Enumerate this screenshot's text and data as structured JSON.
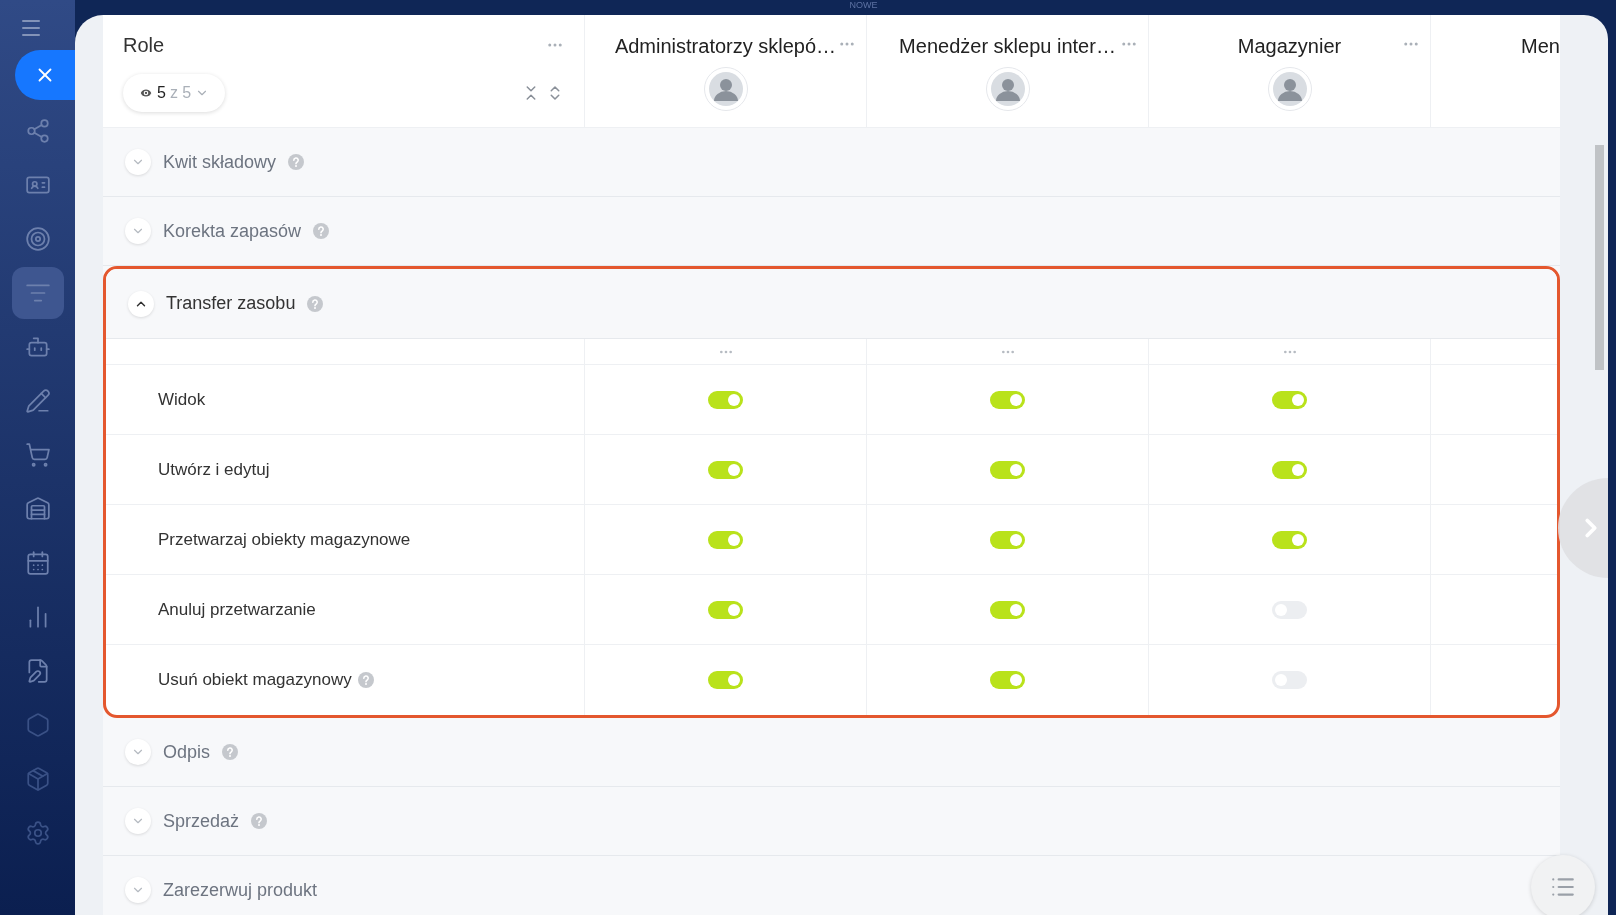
{
  "top_label": "NOWE",
  "roles_header": {
    "title": "Role",
    "visible_count": "5",
    "total_label": "z 5"
  },
  "columns": [
    {
      "title": "Administratorzy sklepó…",
      "avatar": true
    },
    {
      "title": "Menedżer sklepu inter…",
      "avatar": true
    },
    {
      "title": "Magazynier",
      "avatar": true
    },
    {
      "title": "Men",
      "avatar": false
    }
  ],
  "sections": [
    {
      "title": "Kwit składowy",
      "expanded": false,
      "highlighted": false,
      "help": true
    },
    {
      "title": "Korekta zapasów",
      "expanded": false,
      "highlighted": false,
      "help": true
    },
    {
      "title": "Transfer zasobu",
      "expanded": true,
      "highlighted": true,
      "help": true,
      "permissions": [
        {
          "label": "Widok",
          "help": false,
          "values": [
            {
              "on": true
            },
            {
              "on": true
            },
            {
              "on": true
            }
          ]
        },
        {
          "label": "Utwórz i edytuj",
          "help": false,
          "values": [
            {
              "on": true
            },
            {
              "on": true
            },
            {
              "on": true
            }
          ]
        },
        {
          "label": "Przetwarzaj obiekty magazynowe",
          "help": false,
          "values": [
            {
              "on": true
            },
            {
              "on": true
            },
            {
              "on": true
            }
          ]
        },
        {
          "label": "Anuluj przetwarzanie",
          "help": false,
          "values": [
            {
              "on": true
            },
            {
              "on": true
            },
            {
              "on": false
            }
          ]
        },
        {
          "label": "Usuń obiekt magazynowy",
          "help": true,
          "values": [
            {
              "on": true
            },
            {
              "on": true
            },
            {
              "on": false
            }
          ]
        }
      ]
    },
    {
      "title": "Odpis",
      "expanded": false,
      "highlighted": false,
      "help": true
    },
    {
      "title": "Sprzedaż",
      "expanded": false,
      "highlighted": false,
      "help": true
    },
    {
      "title": "Zarezerwuj produkt",
      "expanded": false,
      "highlighted": false,
      "help": false
    }
  ]
}
